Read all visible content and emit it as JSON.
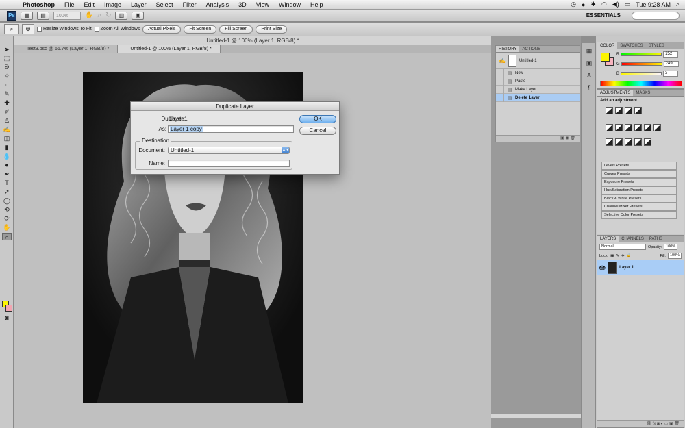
{
  "menubar": {
    "app_name": "Photoshop",
    "items": [
      "File",
      "Edit",
      "Image",
      "Layer",
      "Select",
      "Filter",
      "Analysis",
      "3D",
      "View",
      "Window",
      "Help"
    ],
    "clock": "Tue 9:28 AM"
  },
  "appbar": {
    "zoom": "100%",
    "workspace": "ESSENTIALS"
  },
  "options": {
    "resize_windows": "Resize Windows To Fit",
    "zoom_all": "Zoom All Windows",
    "actual_pixels": "Actual Pixels",
    "fit_screen": "Fit Screen",
    "fill_screen": "Fill Screen",
    "print_size": "Print Size"
  },
  "document": {
    "window_title": "Untitled-1 @ 100% (Layer 1, RGB/8) *",
    "tabs": [
      "Test3.psd @ 66.7% (Layer 1, RGB/8) *",
      "Untitled-1 @ 100% (Layer 1, RGB/8) *"
    ]
  },
  "dialog": {
    "title": "Duplicate Layer",
    "duplicate_label": "Duplicate:",
    "duplicate_value": "Layer 1",
    "as_label": "As:",
    "as_value": "Layer 1 copy",
    "destination_label": "Destination",
    "document_label": "Document:",
    "document_value": "Untitled-1",
    "name_label": "Name:",
    "name_value": "",
    "ok": "OK",
    "cancel": "Cancel"
  },
  "history": {
    "tabs": [
      "HISTORY",
      "ACTIONS"
    ],
    "snapshot": "Untitled-1",
    "states": [
      "New",
      "Paste",
      "Make Layer",
      "Delete Layer"
    ],
    "selected_index": 3
  },
  "color": {
    "tabs": [
      "COLOR",
      "SWATCHES",
      "STYLES"
    ],
    "r_label": "R",
    "g_label": "G",
    "b_label": "B",
    "r": "252",
    "g": "249",
    "b": "3",
    "fg": "#fcf503",
    "bg": "#f7b4bf"
  },
  "adjustments": {
    "tabs": [
      "ADJUSTMENTS",
      "MASKS"
    ],
    "heading": "Add an adjustment",
    "presets": [
      "Levels Presets",
      "Curves Presets",
      "Exposure Presets",
      "Hue/Saturation Presets",
      "Black & White Presets",
      "Channel Mixer Presets",
      "Selective Color Presets"
    ]
  },
  "layers": {
    "tabs": [
      "LAYERS",
      "CHANNELS",
      "PATHS"
    ],
    "blend_mode": "Normal",
    "opacity_label": "Opacity:",
    "opacity": "100%",
    "lock_label": "Lock:",
    "fill_label": "Fill:",
    "fill": "100%",
    "items": [
      "Layer 1"
    ]
  }
}
